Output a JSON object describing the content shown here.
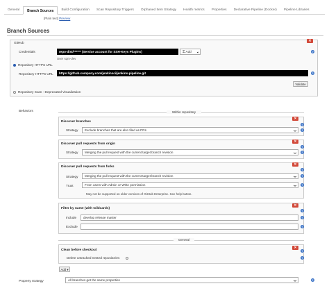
{
  "tabs": [
    "General",
    "Branch Sources",
    "Build Configuration",
    "Scan Repository Triggers",
    "Orphaned Item Strategy",
    "Health metrics",
    "Properties",
    "Declarative Pipeline (Docker)",
    "Pipeline Libraries"
  ],
  "active_tab": "Branch Sources",
  "plain_text": "[Plain text]",
  "preview": "Preview",
  "section_title": "Branch Sources",
  "github": {
    "title": "GitHub",
    "credentials_label": "Credentials",
    "credentials_value": "repo-dist/****** (Service account for SSH-Keys Plugins)",
    "add_label": "Add",
    "user_hint": "User sqm-dev",
    "repo_https_option": "Repository HTTPS URL",
    "repo_https_label": "Repository HTTPS URL",
    "repo_https_value": "https://github.company.com/jenkinsci/jenkins-pipeline.git",
    "validate_label": "Validate",
    "repo_scan_option": "Repository Scan - Deprecated Visualization"
  },
  "behaviors": {
    "label": "Behaviors",
    "within_repository": "Within repository",
    "discover_branches": {
      "title": "Discover branches",
      "strategy_label": "Strategy",
      "strategy_value": "Exclude branches that are also filed as PRs"
    },
    "discover_origin": {
      "title": "Discover pull requests from origin",
      "strategy_label": "Strategy",
      "strategy_value": "Merging the pull request with the current target branch revision"
    },
    "discover_forks": {
      "title": "Discover pull requests from forks",
      "strategy_label": "Strategy",
      "strategy_value": "Merging the pull request with the current target branch revision",
      "trust_label": "Trust",
      "trust_value": "From users with Admin or Write permission",
      "note": "May not be supported on older versions of GitHub Enterprise. See help button."
    },
    "filter": {
      "title": "Filter by name (with wildcards)",
      "include_label": "Include",
      "include_value": "develop release master",
      "exclude_label": "Exclude",
      "exclude_value": ""
    },
    "general": "General",
    "clean": {
      "title": "Clean before checkout",
      "option": "Delete untracked nested repositories"
    },
    "add_label": "Add"
  },
  "property_strategy": {
    "label": "Property strategy",
    "value": "All branches get the same properties"
  },
  "colors": {
    "delete_red": "#d24939",
    "help_blue": "#3b73c7",
    "link_blue": "#2a5db0"
  }
}
